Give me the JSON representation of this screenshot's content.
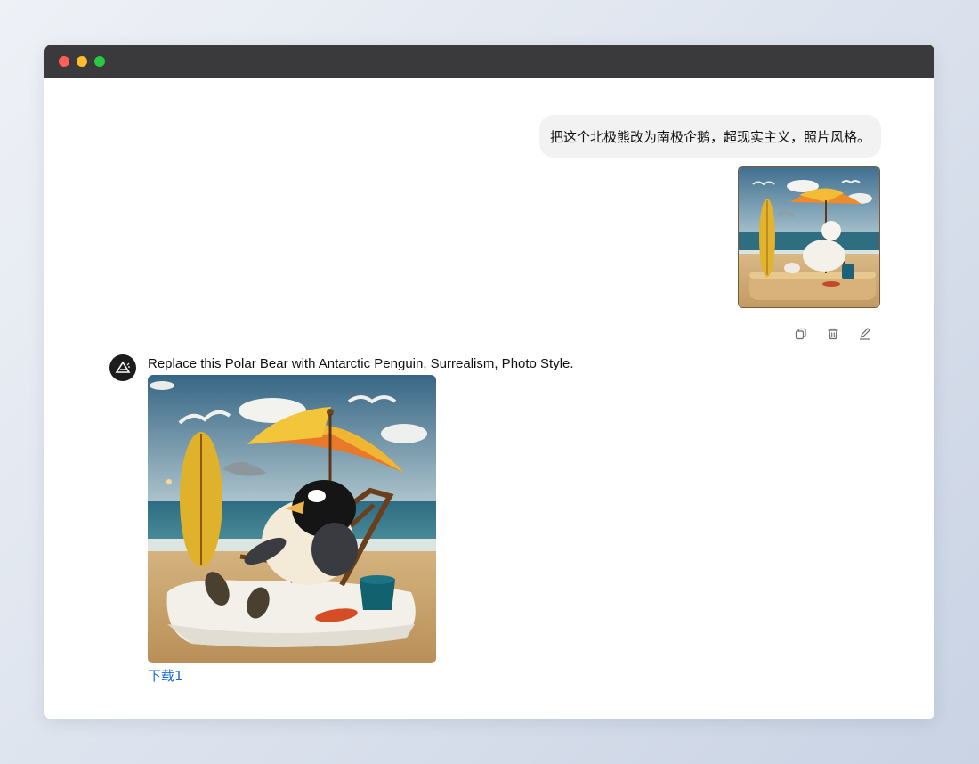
{
  "window": {
    "controls": [
      "close",
      "minimize",
      "maximize"
    ]
  },
  "user_message": {
    "text": "把这个北极熊改为南极企鹅，超现实主义，照片风格。",
    "image_icon": "polar-bear-beach-image"
  },
  "message_actions": [
    {
      "icon": "copy-icon"
    },
    {
      "icon": "trash-icon"
    },
    {
      "icon": "edit-icon"
    }
  ],
  "assistant_message": {
    "avatar_icon": "assistant-logo-icon",
    "text": "Replace this Polar Bear with Antarctic Penguin, Surrealism, Photo Style.",
    "image_icon": "penguin-beach-image",
    "download_label": "下载1"
  },
  "colors": {
    "link": "#1a6ad6",
    "bubble": "#f2f2f3",
    "titlebar": "#3a3a3c"
  }
}
